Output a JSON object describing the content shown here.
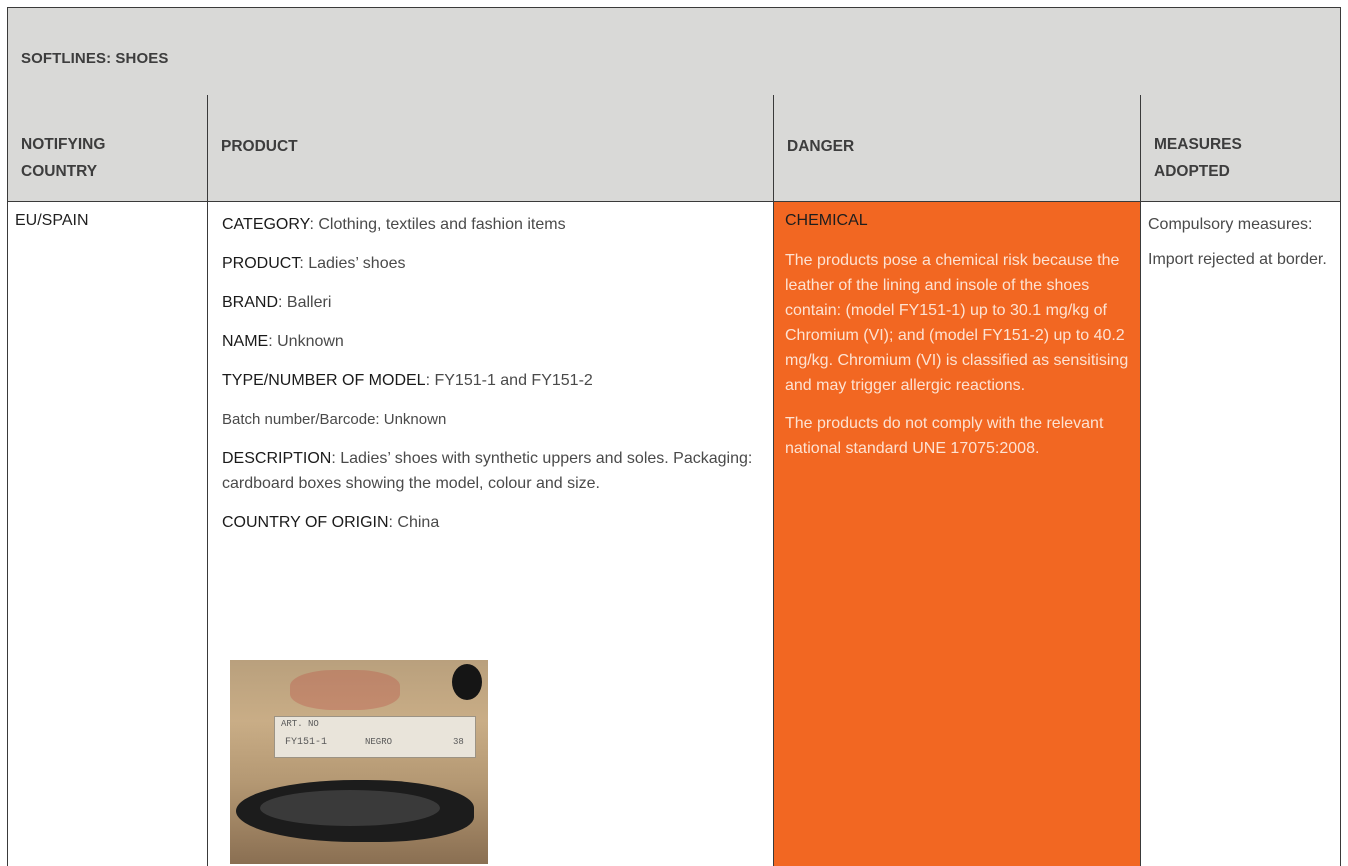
{
  "section": {
    "title": "SOFTLINES: SHOES"
  },
  "headers": {
    "country": "NOTIFYING COUNTRY",
    "product": "PRODUCT",
    "danger": "DANGER",
    "measures": "MEASURES ADOPTED"
  },
  "row": {
    "country": "EU/SPAIN",
    "product": {
      "category_label": "CATEGORY",
      "category": ": Clothing, textiles and fashion items",
      "product_label": "PRODUCT",
      "product": ": Ladies’ shoes",
      "brand_label": "BRAND",
      "brand": ": Balleri",
      "name_label": "NAME",
      "name": ": Unknown",
      "model_label": "TYPE/NUMBER OF MODEL",
      "model": ": FY151-1 and FY151-2",
      "batch": "Batch number/Barcode: Unknown",
      "description_label": "DESCRIPTION",
      "description": ": Ladies’ shoes with synthetic uppers and soles. Packaging: cardboard boxes showing the model, colour and size.",
      "origin_label": "COUNTRY OF ORIGIN",
      "origin": ": China"
    },
    "danger": {
      "title": "CHEMICAL",
      "paragraph1": "The products pose a chemical risk because the leather of the lining and insole of the shoes contain: (model FY151-1) up to 30.1 mg/kg of Chromium (VI); and (model FY151-2) up to 40.2 mg/kg. Chromium (VI) is classified as sensitising and may trigger allergic reactions.",
      "paragraph2": "The products do not comply with the relevant national standard UNE 17075:2008.",
      "color": "#f26722"
    },
    "measures": {
      "line1": "Compulsory measures:",
      "line2": "Import rejected at border."
    }
  },
  "photo": {
    "label_art": "ART. NO",
    "label_model": "FY151-1",
    "label_color": "NEGRO",
    "label_size": "38"
  }
}
